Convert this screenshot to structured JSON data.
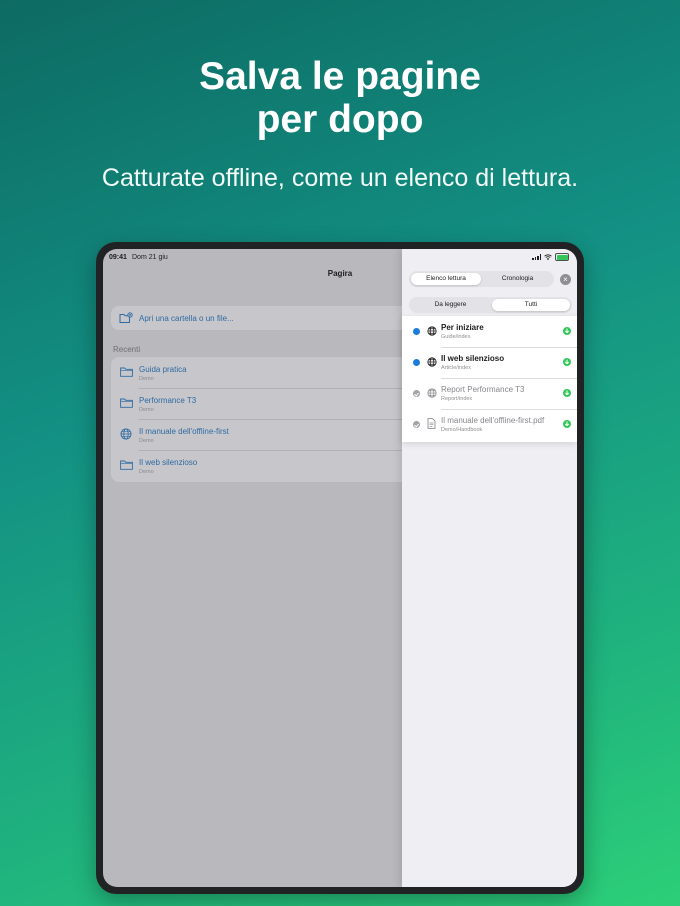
{
  "promo": {
    "headline_line1": "Salva le pagine",
    "headline_line2": "per dopo",
    "subheadline": "Catturate offline, come un elenco di lettura."
  },
  "status_bar": {
    "time": "09:41",
    "date": "Dom 21 giu"
  },
  "app": {
    "title": "Pagira",
    "open_action": "Apri una cartella o un file...",
    "recents_label": "Recenti",
    "recents": [
      {
        "title": "Guida pratica",
        "subtitle": "Demo",
        "icon": "folder-icon"
      },
      {
        "title": "Performance T3",
        "subtitle": "Demo",
        "icon": "folder-icon"
      },
      {
        "title": "Il manuale dell'offline-first",
        "subtitle": "Demo",
        "icon": "globe-icon"
      },
      {
        "title": "Il web silenzioso",
        "subtitle": "Demo",
        "icon": "folder-icon"
      }
    ]
  },
  "panel": {
    "tabs": [
      {
        "label": "Elenco lettura",
        "active": true
      },
      {
        "label": "Cronologia",
        "active": false
      }
    ],
    "close_icon": "×",
    "filters": [
      {
        "label": "Da leggere",
        "active": false
      },
      {
        "label": "Tutti",
        "active": true
      }
    ],
    "items": [
      {
        "title": "Per iniziare",
        "path": "Guide/index",
        "read": false,
        "icon": "globe-icon"
      },
      {
        "title": "Il web silenzioso",
        "path": "Article/index",
        "read": false,
        "icon": "globe-icon"
      },
      {
        "title": "Report Performance T3",
        "path": "Report/index",
        "read": true,
        "icon": "globe-icon"
      },
      {
        "title": "Il manuale dell'offline-first.pdf",
        "path": "Demo/Handbook",
        "read": true,
        "icon": "document-icon"
      }
    ]
  },
  "colors": {
    "accent_blue": "#1a7ddb",
    "download_green": "#34c759",
    "link_blue": "#2f6aa3"
  }
}
